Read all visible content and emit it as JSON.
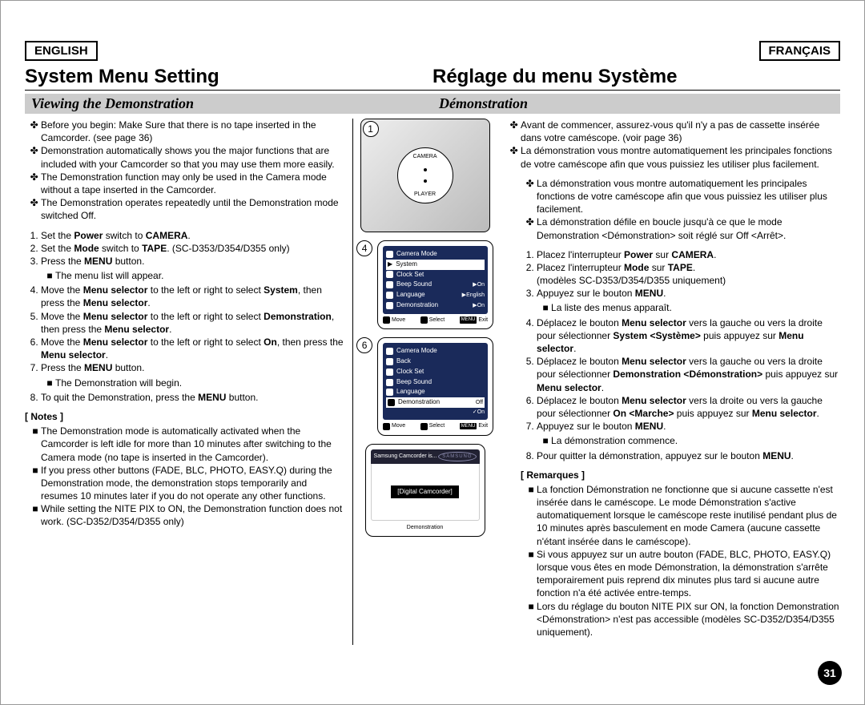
{
  "langs": {
    "en": "ENGLISH",
    "fr": "FRANÇAIS"
  },
  "titles": {
    "en": "System Menu Setting",
    "fr": "Réglage du menu Système"
  },
  "subtitles": {
    "en": "Viewing the Demonstration",
    "fr": "Démonstration"
  },
  "page_number": "31",
  "en": {
    "bul1": "Before you begin: Make Sure that there is no tape inserted in the Camcorder. (see page 36)",
    "bul2": "Demonstration automatically shows you the major functions that are included with your Camcorder so that you may use them more easily.",
    "bul3": "The Demonstration function may only be used in the Camera mode without a tape inserted in the Camcorder.",
    "bul4": "The Demonstration operates repeatedly until the Demonstration mode switched Off.",
    "step1_a": "Set the ",
    "step1_b": "Power",
    "step1_c": " switch to ",
    "step1_d": "CAMERA",
    "step1_e": ".",
    "step2_a": "Set the ",
    "step2_b": "Mode",
    "step2_c": " switch to ",
    "step2_d": "TAPE",
    "step2_e": ". (SC-D353/D354/D355 only)",
    "step3_a": "Press the ",
    "step3_b": "MENU",
    "step3_c": " button.",
    "step3_sub": "The menu list will appear.",
    "step4_a": "Move the ",
    "step4_b": "Menu selector",
    "step4_c": " to the left or right to select ",
    "step4_d": "System",
    "step4_e": ", then press the ",
    "step4_f": "Menu selector",
    "step4_g": ".",
    "step5_a": "Move the ",
    "step5_b": "Menu selector",
    "step5_c": " to the left or right to select ",
    "step5_d": "Demonstration",
    "step5_e": ", then press the ",
    "step5_f": "Menu selector",
    "step5_g": ".",
    "step6_a": "Move the ",
    "step6_b": "Menu selector",
    "step6_c": " to the left or right to select ",
    "step6_d": "On",
    "step6_e": ", then press the ",
    "step6_f": "Menu selector",
    "step6_g": ".",
    "step7_a": "Press the ",
    "step7_b": "MENU",
    "step7_c": " button.",
    "step7_sub": "The Demonstration will begin.",
    "step8_a": "To quit the Demonstration, press the ",
    "step8_b": "MENU",
    "step8_c": " button.",
    "notes_head": "[ Notes ]",
    "note1": "The Demonstration mode is automatically activated when the Camcorder is left idle for more than 10 minutes after switching to the Camera mode (no tape is inserted in the Camcorder).",
    "note2": "If you press other buttons (FADE, BLC, PHOTO, EASY.Q) during the Demonstration mode, the demonstration stops temporarily and resumes 10 minutes later if you do not operate any other functions.",
    "note3": "While setting the NITE PIX to ON, the Demonstration function does not work. (SC-D352/D354/D355 only)"
  },
  "fr": {
    "bul1": "Avant de commencer, assurez-vous qu'il n'y a pas de cassette insérée dans votre caméscope. (voir page 36)",
    "bul2": "La démonstration vous montre automatiquement les principales fonctions de votre caméscope afin que vous puissiez les utiliser plus facilement.",
    "bul2a": "La démonstration vous montre automatiquement les principales fonctions de votre caméscope afin que vous puissiez les utiliser plus facilement.",
    "bul3": "La démonstration défile en boucle jusqu'à ce que le mode Demonstration <Démonstration> soit réglé sur Off <Arrêt>.",
    "step1_a": "Placez l'interrupteur ",
    "step1_b": "Power",
    "step1_c": " sur ",
    "step1_d": "CAMERA",
    "step1_e": ".",
    "step2_a": "Placez l'interrupteur ",
    "step2_b": "Mode",
    "step2_c": " sur ",
    "step2_d": "TAPE",
    "step2_e": ".",
    "step2_f": "(modèles SC-D353/D354/D355 uniquement)",
    "step3_a": "Appuyez sur le bouton ",
    "step3_b": "MENU",
    "step3_c": ".",
    "step3_sub": "La liste des menus apparaît.",
    "step4_a": "Déplacez le bouton ",
    "step4_b": "Menu selector",
    "step4_c": " vers la gauche ou vers la droite pour sélectionner ",
    "step4_d": "System <Système>",
    "step4_e": " puis appuyez sur ",
    "step4_f": "Menu selector",
    "step4_g": ".",
    "step5_a": "Déplacez le bouton ",
    "step5_b": "Menu selector",
    "step5_c": " vers la gauche ou vers la droite pour sélectionner ",
    "step5_d": "Demonstration <Démonstration>",
    "step5_e": " puis appuyez sur ",
    "step5_f": "Menu selector",
    "step5_g": ".",
    "step6_a": "Déplacez le bouton ",
    "step6_b": "Menu selector",
    "step6_c": " vers la droite ou vers la gauche pour sélectionner ",
    "step6_d": "On <Marche>",
    "step6_e": " puis appuyez sur ",
    "step6_f": "Menu selector",
    "step6_g": ".",
    "step7_a": "Appuyez sur le bouton ",
    "step7_b": "MENU",
    "step7_c": ".",
    "step7_sub": "La démonstration commence.",
    "step8_a": "Pour quitter la démonstration, appuyez sur le bouton ",
    "step8_b": "MENU",
    "step8_c": ".",
    "notes_head": "[ Remarques ]",
    "note1": "La fonction Démonstration ne fonctionne que si aucune cassette n'est insérée dans le caméscope. Le mode Démonstration s'active automatiquement lorsque le caméscope reste inutilisé pendant plus de 10 minutes après basculement en mode Camera (aucune cassette n'étant insérée dans le caméscope).",
    "note2": "Si vous appuyez sur un autre bouton (FADE, BLC, PHOTO, EASY.Q) lorsque vous êtes en mode Démonstration, la démonstration s'arrête temporairement puis reprend dix minutes plus tard si aucune autre fonction n'a été activée entre-temps.",
    "note3": "Lors du réglage du bouton NITE PIX sur ON, la fonction Demonstration <Démonstration> n'est pas accessible (modèles SC-D352/D354/D355 uniquement)."
  },
  "fig": {
    "n1": "1",
    "n4": "4",
    "n6": "6",
    "dial_camera": "CAMERA",
    "dial_player": "PLAYER",
    "lcd4": {
      "title": "Camera Mode",
      "system": "System",
      "clock": "Clock Set",
      "beep": "Beep Sound",
      "beep_val": "On",
      "lang": "Language",
      "lang_val": "English",
      "demo": "Demonstration",
      "demo_val": "On",
      "move": "Move",
      "select": "Select",
      "exit": "Exit",
      "menu": "MENU"
    },
    "lcd6": {
      "title": "Camera Mode",
      "back": "Back",
      "clock": "Clock Set",
      "beep": "Beep Sound",
      "lang": "Language",
      "demo": "Demonstration",
      "off": "Off",
      "on": "On",
      "move": "Move",
      "select": "Select",
      "exit": "Exit",
      "menu": "MENU"
    },
    "demo": {
      "top": "Samsung Camcorder is...",
      "brand": "SAMSUNG",
      "box": "[Digital Camcorder]",
      "bottom": "Demonstration"
    }
  }
}
